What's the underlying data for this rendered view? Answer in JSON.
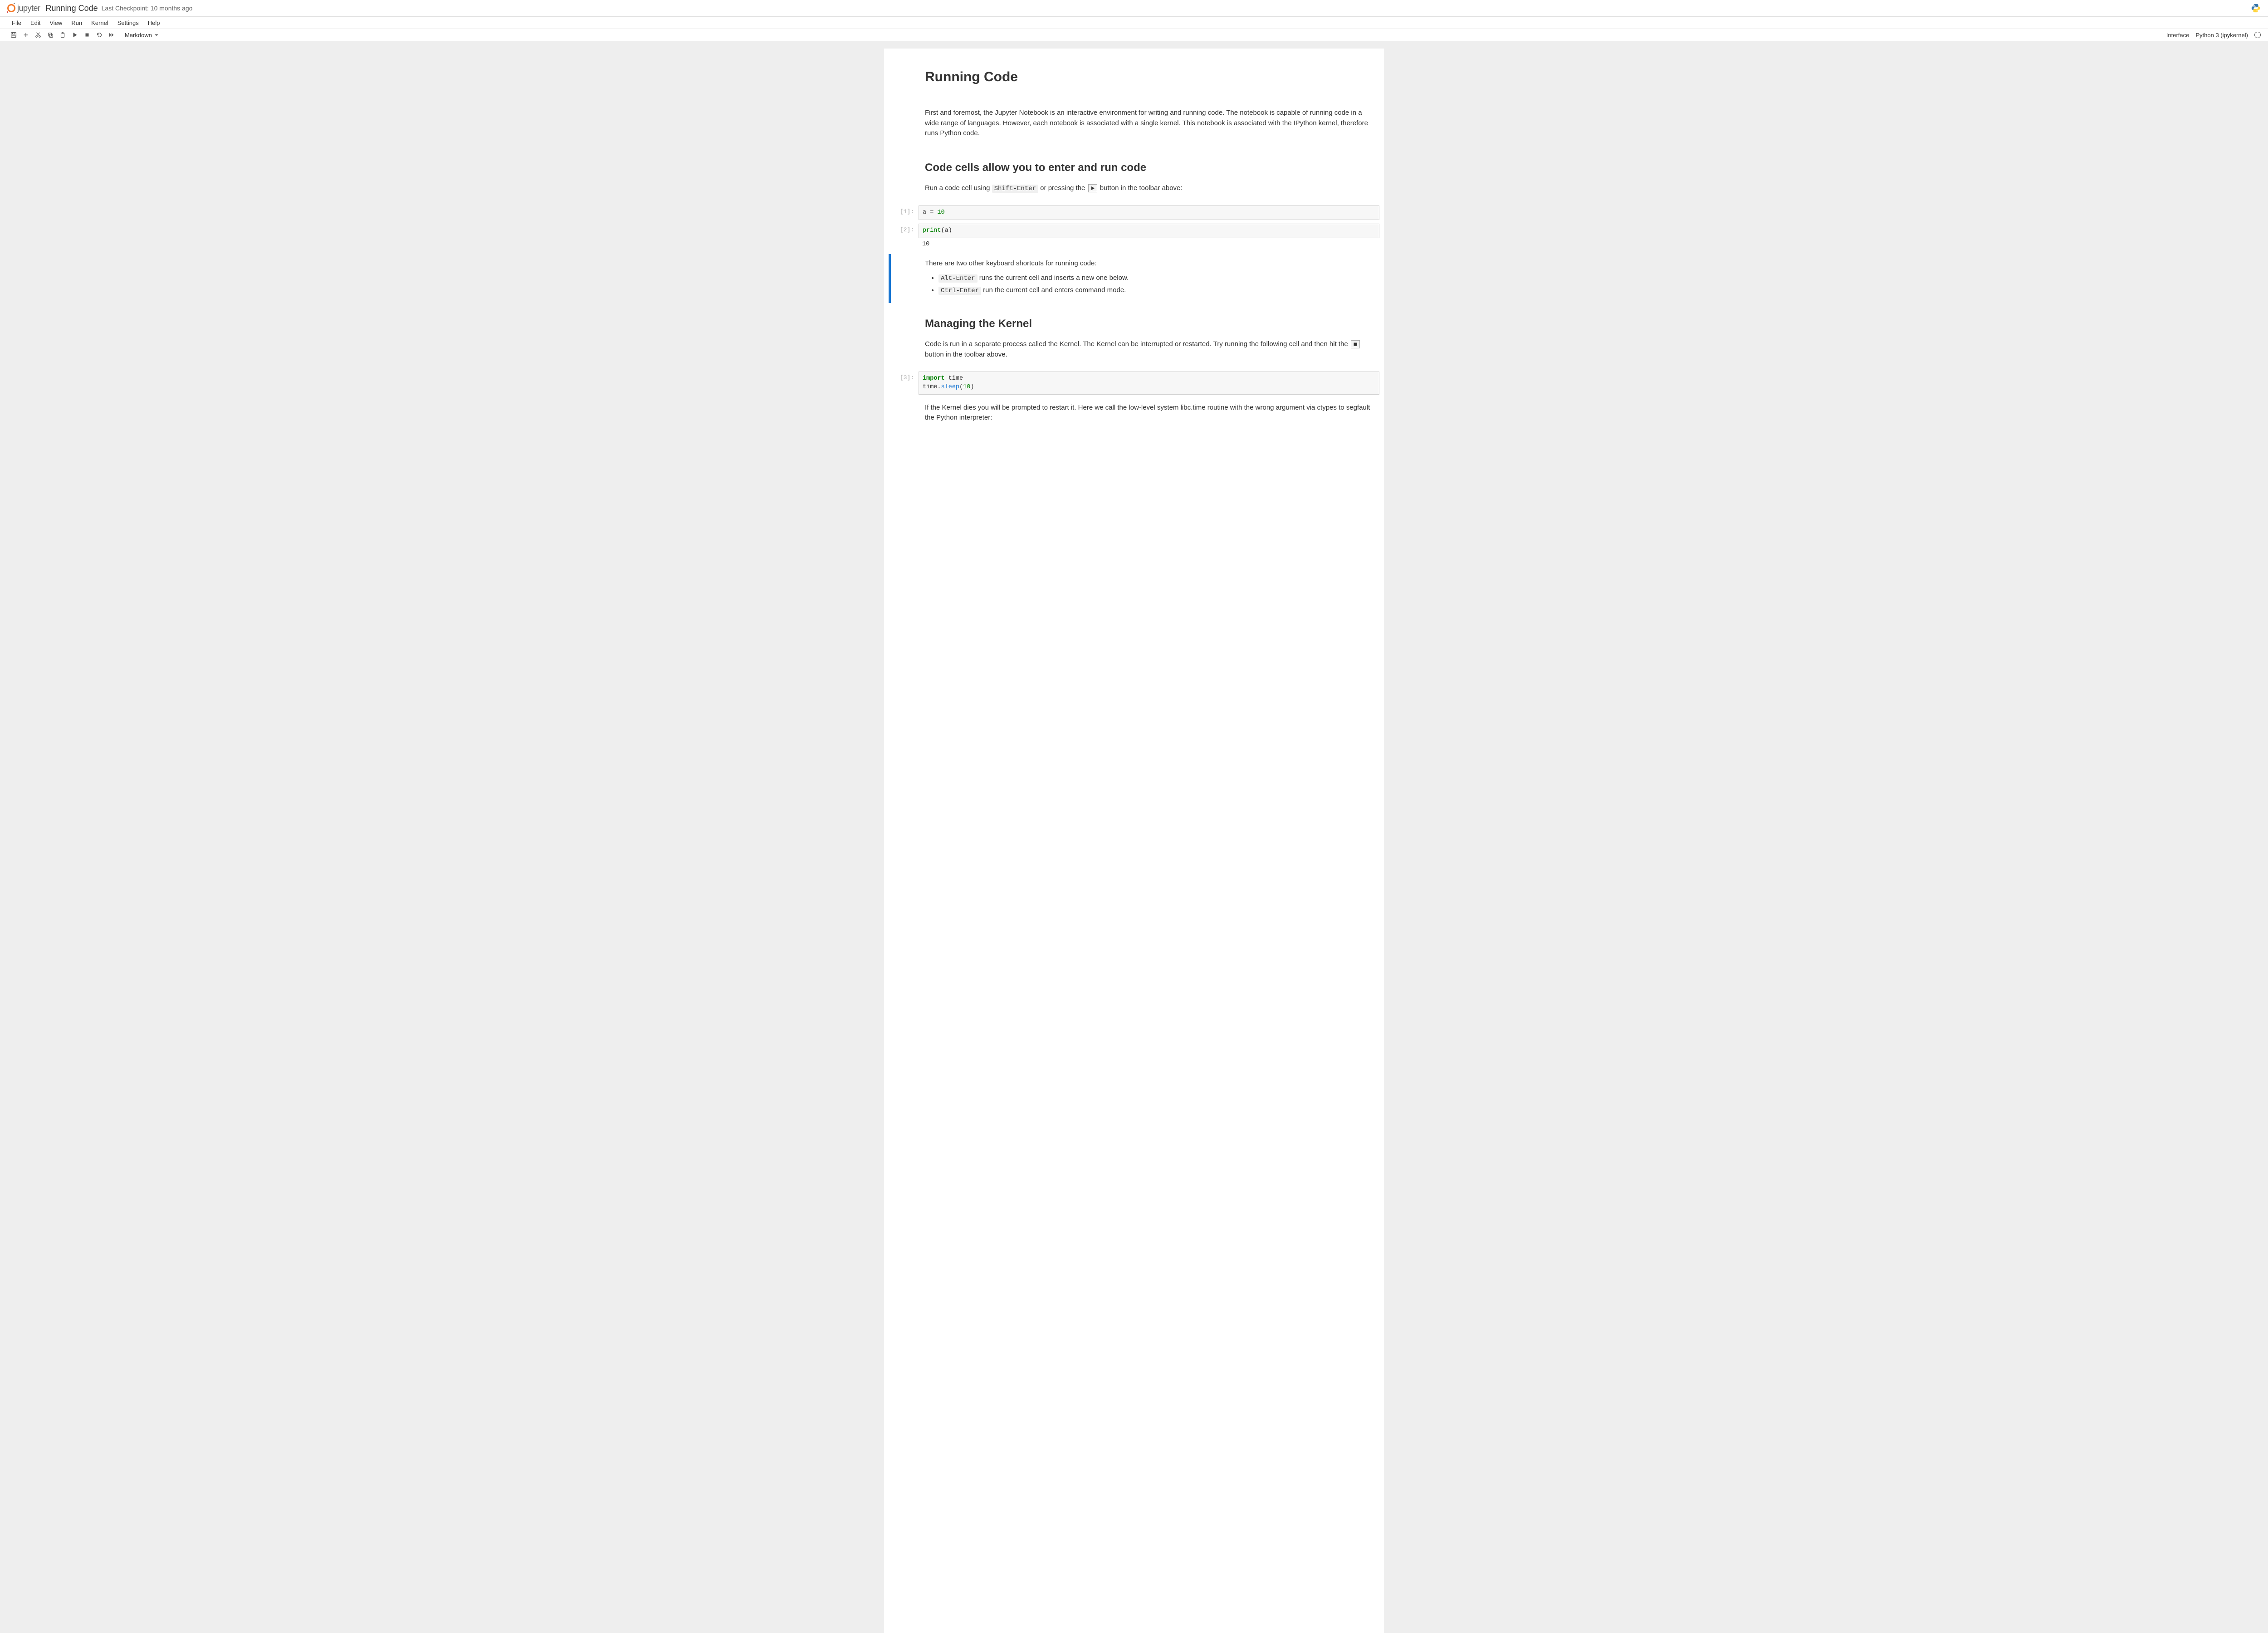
{
  "header": {
    "logo_text": "jupyter",
    "notebook_title": "Running Code",
    "checkpoint": "Last Checkpoint: 10 months ago"
  },
  "menubar": [
    "File",
    "Edit",
    "View",
    "Run",
    "Kernel",
    "Settings",
    "Help"
  ],
  "toolbar": {
    "cell_type": "Markdown",
    "interface_label": "Interface",
    "kernel_label": "Python 3 (ipykernel)"
  },
  "cells": {
    "md_title": "Running Code",
    "md_intro": "First and foremost, the Jupyter Notebook is an interactive environment for writing and running code. The notebook is capable of running code in a wide range of languages. However, each notebook is associated with a single kernel. This notebook is associated with the IPython kernel, therefore runs Python code.",
    "md_h2_codecells": "Code cells allow you to enter and run code",
    "md_run_p1a": "Run a code cell using ",
    "md_run_code1": "Shift-Enter",
    "md_run_p1b": " or pressing the ",
    "md_run_p1c": " button in the toolbar above:",
    "code1_prompt": "[1]:",
    "code1_src_a": "a",
    "code1_src_eq": " = ",
    "code1_src_10": "10",
    "code2_prompt": "[2]:",
    "code2_src_print": "print",
    "code2_src_paren_a": "(a)",
    "code2_out": "10",
    "md_shortcuts_intro": "There are two other keyboard shortcuts for running code:",
    "md_li1_code": "Alt-Enter",
    "md_li1_text": " runs the current cell and inserts a new one below.",
    "md_li2_code": "Ctrl-Enter",
    "md_li2_text": " run the current cell and enters command mode.",
    "md_h2_kernel": "Managing the Kernel",
    "md_kernel_p1a": "Code is run in a separate process called the Kernel. The Kernel can be interrupted or restarted. Try running the following cell and then hit the ",
    "md_kernel_p1b": " button in the toolbar above.",
    "code3_prompt": "[3]:",
    "code3_kw_import": "import",
    "code3_time": " time",
    "code3_line2a": "time.",
    "code3_sleep": "sleep",
    "code3_paren_open": "(",
    "code3_ten": "10",
    "code3_paren_close": ")",
    "md_kernel_die": "If the Kernel dies you will be prompted to restart it. Here we call the low-level system libc.time routine with the wrong argument via ctypes to segfault the Python interpreter:"
  }
}
